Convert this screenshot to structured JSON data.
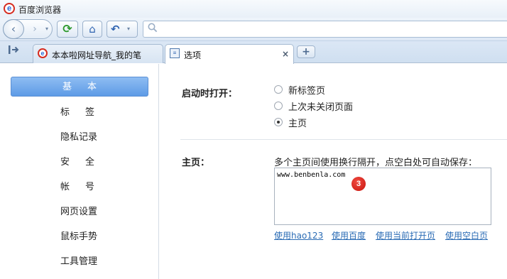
{
  "window": {
    "title": "百度浏览器",
    "logo_letter": "e"
  },
  "toolbar": {
    "back_glyph": "‹",
    "forward_glyph": "›",
    "dropdown_glyph": "▾",
    "refresh_glyph": "⟳",
    "home_glyph": "⌂",
    "undo_glyph": "↶",
    "address_value": ""
  },
  "tabs": [
    {
      "label": "本本啦网址导航_我的笔",
      "close": "",
      "active": false
    },
    {
      "label": "选项",
      "close": "×",
      "active": true
    }
  ],
  "new_tab_glyph": "+",
  "sidebar": {
    "items": [
      {
        "label": "基本",
        "active": true
      },
      {
        "label": "标签",
        "active": false
      },
      {
        "label": "隐私记录",
        "active": false
      },
      {
        "label": "安全",
        "active": false
      },
      {
        "label": "帐号",
        "active": false
      },
      {
        "label": "网页设置",
        "active": false
      },
      {
        "label": "鼠标手势",
        "active": false
      },
      {
        "label": "工具管理",
        "active": false
      }
    ]
  },
  "startup": {
    "label": "启动时打开：",
    "options": [
      {
        "label": "新标签页",
        "selected": false
      },
      {
        "label": "上次未关闭页面",
        "selected": false
      },
      {
        "label": "主页",
        "selected": true
      }
    ]
  },
  "homepage": {
    "label": "主页：",
    "hint": "多个主页间使用换行隔开，点空白处可自动保存：",
    "value": "www.benbenla.com",
    "badge": "3",
    "links": [
      "使用hao123",
      "使用百度",
      "使用当前打开页",
      "使用空白页"
    ]
  }
}
